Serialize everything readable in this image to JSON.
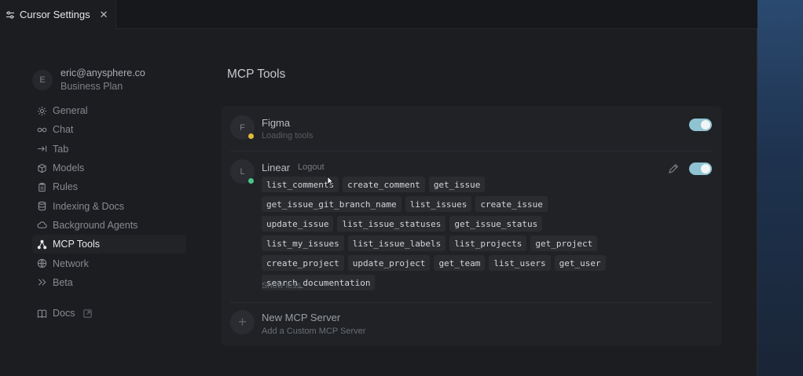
{
  "window": {
    "tab_title": "Cursor Settings"
  },
  "account": {
    "initial": "E",
    "email": "eric@anysphere.co",
    "plan": "Business Plan"
  },
  "nav": {
    "items": [
      {
        "label": "General",
        "icon": "gear-icon"
      },
      {
        "label": "Chat",
        "icon": "infinity-icon"
      },
      {
        "label": "Tab",
        "icon": "arrow-right-bar-icon"
      },
      {
        "label": "Models",
        "icon": "cube-icon"
      },
      {
        "label": "Rules",
        "icon": "clipboard-icon"
      },
      {
        "label": "Indexing & Docs",
        "icon": "database-icon"
      },
      {
        "label": "Background Agents",
        "icon": "cloud-icon"
      },
      {
        "label": "MCP Tools",
        "icon": "nodes-icon",
        "active": true
      },
      {
        "label": "Network",
        "icon": "globe-icon"
      },
      {
        "label": "Beta",
        "icon": "chevrons-right-icon"
      }
    ],
    "docs_label": "Docs"
  },
  "main": {
    "title": "MCP Tools",
    "servers": [
      {
        "initial": "F",
        "name": "Figma",
        "status": "Loading tools",
        "status_color": "#e0b93a",
        "enabled": true
      },
      {
        "initial": "L",
        "name": "Linear",
        "logout_label": "Logout",
        "status_color": "#4cc38a",
        "enabled": true,
        "tools": [
          "list_comments",
          "create_comment",
          "get_issue",
          "get_issue_git_branch_name",
          "list_issues",
          "create_issue",
          "update_issue",
          "list_issue_statuses",
          "get_issue_status",
          "list_my_issues",
          "list_issue_labels",
          "list_projects",
          "get_project",
          "create_project",
          "update_project",
          "get_team",
          "list_users",
          "get_user",
          "search_documentation"
        ],
        "show_less_label": "Show less"
      }
    ],
    "new_server": {
      "title": "New MCP Server",
      "subtitle": "Add a Custom MCP Server"
    }
  },
  "colors": {
    "toggle_on": "#8fc3d2",
    "active_nav_bg": "#212327"
  }
}
